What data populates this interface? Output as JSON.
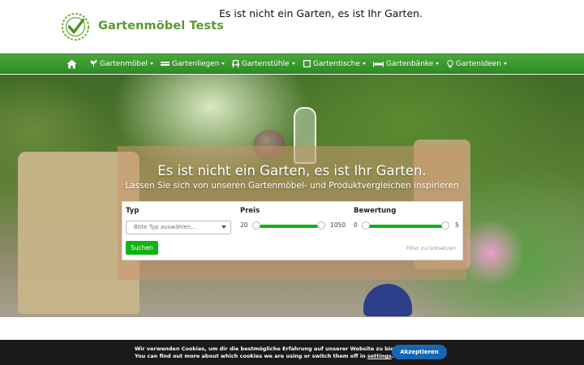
{
  "site": {
    "logo_text": "Gartenmöbel Tests",
    "tagline": "Es ist nicht ein Garten, es ist Ihr Garten."
  },
  "nav": {
    "home_icon": "home-icon",
    "items": [
      {
        "label": "Gartenmöbel",
        "icon": "plant-icon"
      },
      {
        "label": "Gartenliegen",
        "icon": "lounger-icon"
      },
      {
        "label": "Gartenstühle",
        "icon": "chair-icon"
      },
      {
        "label": "Gartentische",
        "icon": "table-icon"
      },
      {
        "label": "Gartenbänke",
        "icon": "bench-icon"
      },
      {
        "label": "Gartenideen",
        "icon": "lightbulb-icon"
      }
    ]
  },
  "hero": {
    "title": "Es ist nicht ein Garten, es ist Ihr Garten.",
    "subtitle": "Lassen Sie sich von unseren Gartenmöbel- und Produktvergleichen inspirieren"
  },
  "filter": {
    "type_label": "Typ",
    "type_placeholder": "Bitte Typ auswählen...",
    "price_label": "Preis",
    "price_min": "20",
    "price_max": "1050",
    "rating_label": "Bewertung",
    "rating_min": "0",
    "rating_max": "5",
    "search_button": "Suchen",
    "reset_link": "Filter zurücksetzen"
  },
  "cookie": {
    "line1": "Wir verwenden Cookies, um dir die bestmögliche Erfahrung auf unserer Website zu bieten.",
    "line2_prefix": "You can find out more about which cookies we are using or switch them off in ",
    "line2_link": "settings",
    "line2_suffix": ".",
    "accept_button": "Akzeptieren"
  },
  "colors": {
    "brand_green": "#5a9a2e",
    "nav_green": "#3a962e",
    "accent_green": "#11b211",
    "cookie_button": "#1767b3"
  }
}
